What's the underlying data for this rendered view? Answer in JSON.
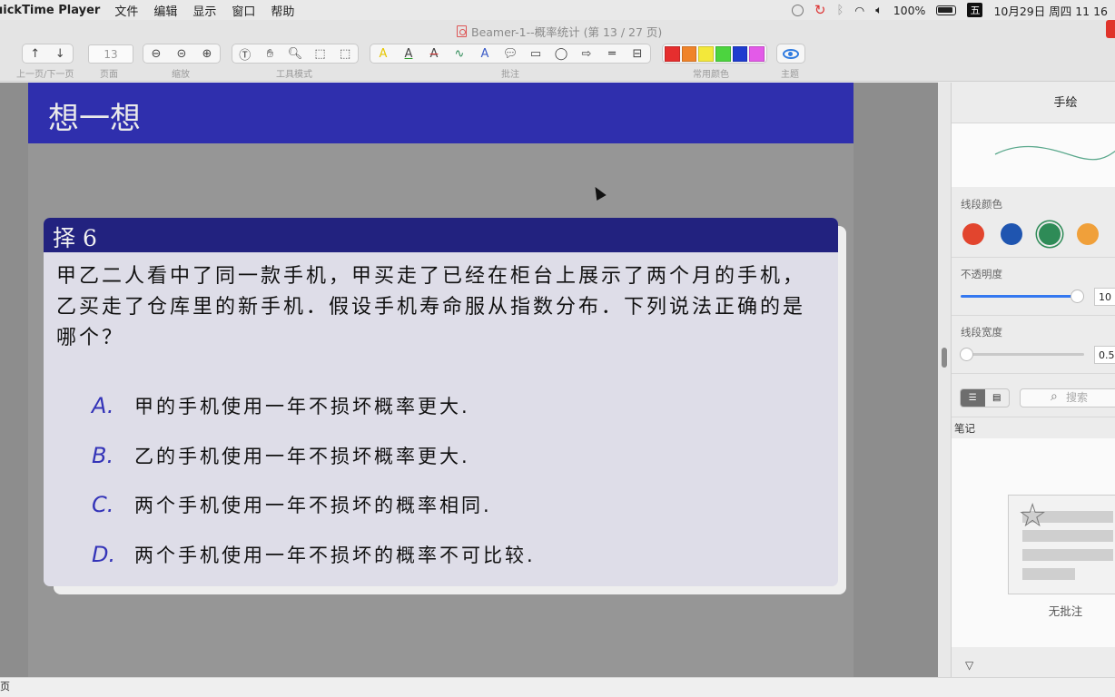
{
  "menubar": {
    "app_name": "uickTime Player",
    "menus": [
      "文件",
      "编辑",
      "显示",
      "窗口",
      "帮助"
    ],
    "battery": "100%",
    "ime": "五",
    "datetime": "10月29日 周四  11 16"
  },
  "window": {
    "title": "Beamer-1--概率统计 (第 13 / 27 页)"
  },
  "toolbar": {
    "page_number": "13",
    "labels": {
      "nav": "上一页/下一页",
      "page": "页面",
      "zoom": "缩放",
      "tool_mode": "工具模式",
      "annotate": "批注",
      "common_colors": "常用颜色",
      "theme": "主题"
    },
    "colors": [
      "#e62e2e",
      "#f0832a",
      "#f3e83a",
      "#4cd43f",
      "#1f3ccf",
      "#e35ae8"
    ]
  },
  "slide": {
    "header_title": "想一想",
    "block_title": "择 6",
    "question": "甲乙二人看中了同一款手机，甲买走了已经在柜台上展示了两个月的手机，乙买走了仓库里的新手机．假设手机寿命服从指数分布．下列说法正确的是哪个？",
    "options": [
      {
        "key": "A.",
        "text": "甲的手机使用一年不损坏概率更大."
      },
      {
        "key": "B.",
        "text": "乙的手机使用一年不损坏概率更大."
      },
      {
        "key": "C.",
        "text": "两个手机使用一年不损坏的概率相同."
      },
      {
        "key": "D.",
        "text": "两个手机使用一年不损坏的概率不可比较."
      }
    ]
  },
  "sidebar": {
    "title": "手绘",
    "line_color_label": "线段颜色",
    "line_colors": [
      "#e2452e",
      "#1f55b0",
      "#2e8b57",
      "#f0a03a"
    ],
    "opacity_label": "不透明度",
    "opacity_value": "10",
    "width_label": "线段宽度",
    "width_value": "0.5",
    "search_placeholder": "搜索",
    "notes_label": "笔记",
    "empty_text": "无批注"
  },
  "statusbar": {
    "text": "页"
  }
}
